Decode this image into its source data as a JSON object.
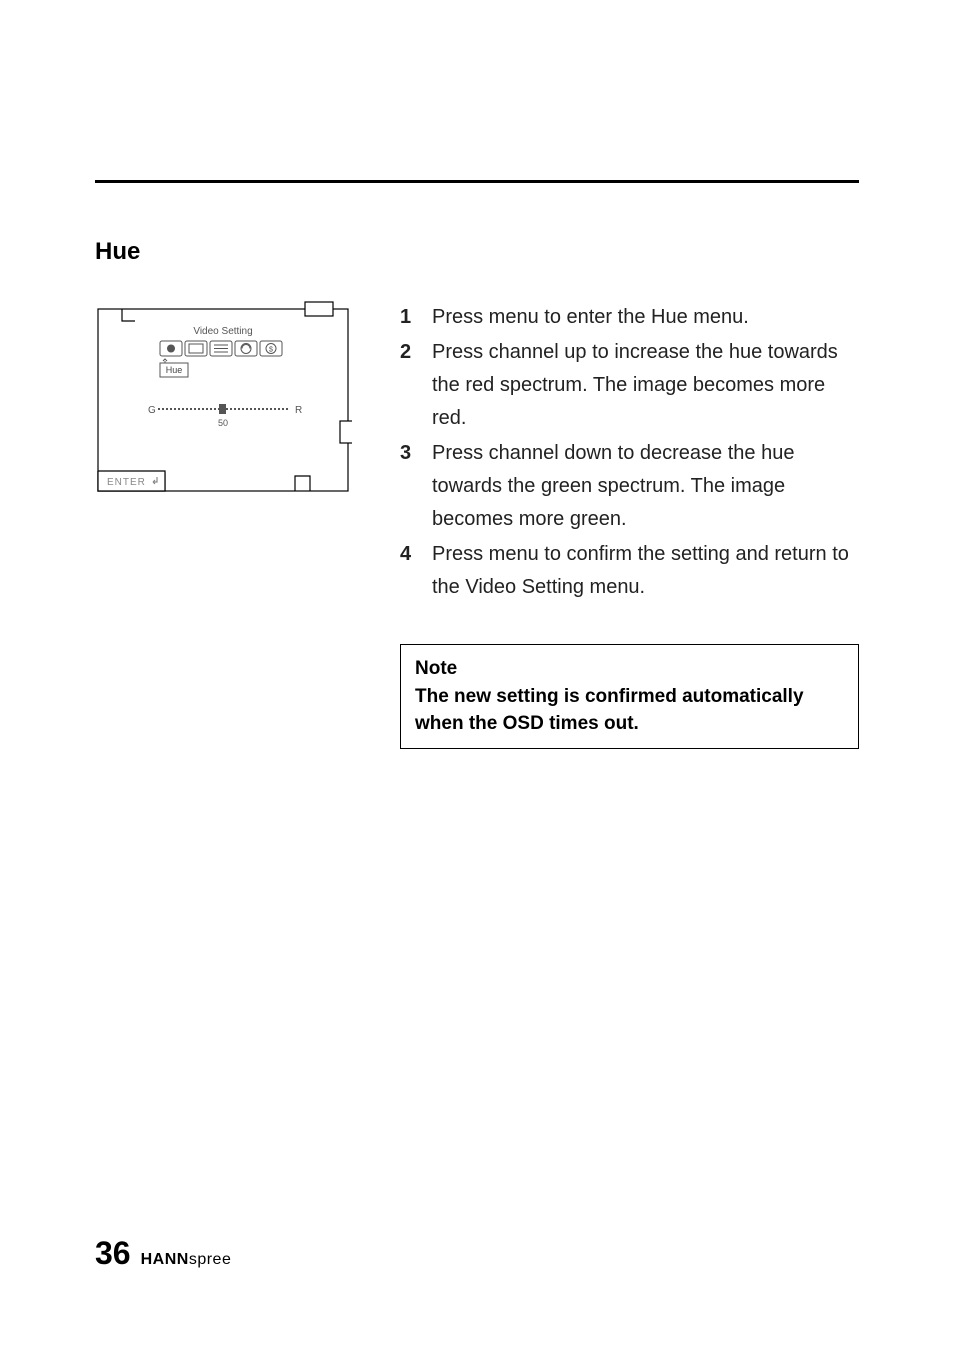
{
  "section": {
    "title": "Hue"
  },
  "diagram": {
    "title": "Video Setting",
    "label": "Hue",
    "left": "G",
    "right": "R",
    "value": "50",
    "enter": "ENTER"
  },
  "steps": [
    "Press menu to enter the Hue menu.",
    "Press channel up to increase the hue towards the red spectrum. The image becomes more red.",
    "Press channel down to decrease the hue towards the green spectrum. The image becomes more green.",
    "Press menu to confirm the setting and return to the Video Setting menu."
  ],
  "note": {
    "heading": "Note",
    "body": "The new setting is confirmed automatically when the OSD times out."
  },
  "footer": {
    "page": "36",
    "brand_bold": "HANN",
    "brand_light": "spree"
  }
}
